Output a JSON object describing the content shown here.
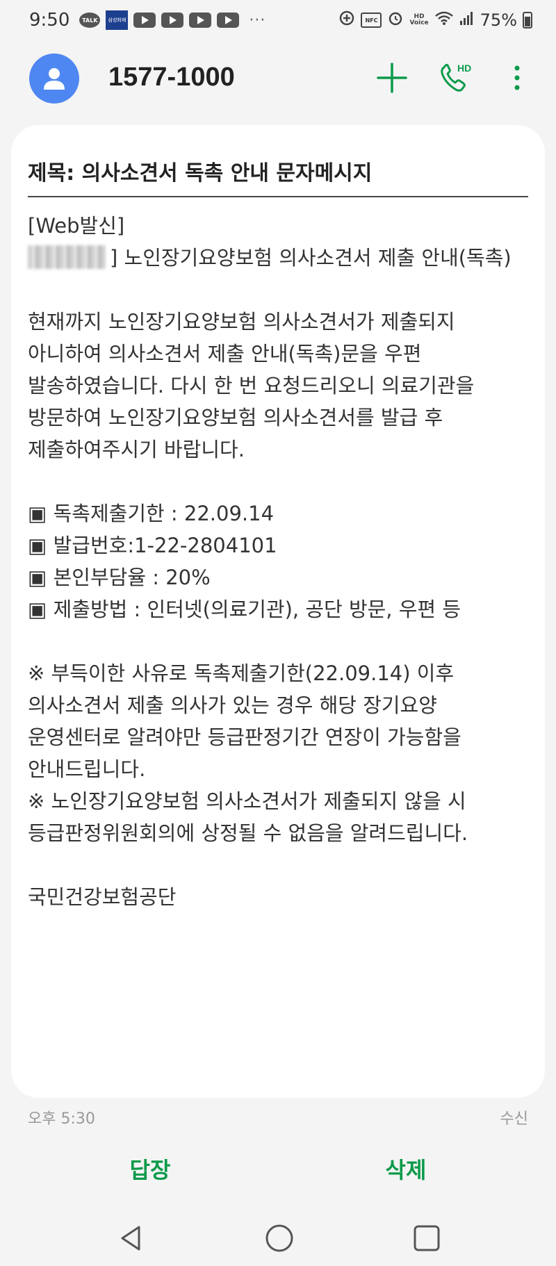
{
  "status_bar": {
    "time": "9:50",
    "talk_badge": "TALK",
    "bank_badge": "삼성화재",
    "more": "···",
    "nfc": "NFC",
    "hd_voice": "HD\nVoice",
    "battery": "75%"
  },
  "header": {
    "contact_number": "1577-1000",
    "hd_badge": "HD",
    "icons": [
      "avatar-icon",
      "add-icon",
      "hd-call-icon",
      "more-icon"
    ],
    "accent_color": "#0c9a4a"
  },
  "message": {
    "subject": "제목: 의사소견서 독촉 안내 문자메시지",
    "web_tag": "[Web발신]",
    "notice_title": "] 노인장기요양보험 의사소견서 제출 안내(독촉)",
    "paragraph1": [
      "현재까지 노인장기요양보험 의사소견서가 제출되지",
      "아니하여 의사소견서 제출 안내(독촉)문을 우편",
      "발송하였습니다. 다시 한 번 요청드리오니 의료기관을",
      "방문하여 노인장기요양보험 의사소견서를 발급 후",
      "제출하여주시기 바랍니다."
    ],
    "details": [
      "▣ 독촉제출기한 : 22.09.14",
      "▣ 발급번호:1-22-2804101",
      "▣ 본인부담율 : 20%",
      "▣ 제출방법 : 인터넷(의료기관), 공단 방문, 우편 등"
    ],
    "notes": [
      "※ 부득이한 사유로 독촉제출기한(22.09.14) 이후",
      "의사소견서 제출 의사가 있는 경우 해당 장기요양",
      "운영센터로 알려야만 등급판정기간 연장이 가능함을",
      "안내드립니다.",
      "※ 노인장기요양보험 의사소견서가 제출되지 않을 시",
      "등급판정위원회의에 상정될 수 없음을 알려드립니다."
    ],
    "sender": "국민건강보험공단",
    "time": "오후 5:30",
    "status": "수신"
  },
  "actions": {
    "reply": "답장",
    "delete": "삭제"
  },
  "nav": {
    "icons": [
      "back-icon",
      "home-icon",
      "recents-icon"
    ]
  }
}
